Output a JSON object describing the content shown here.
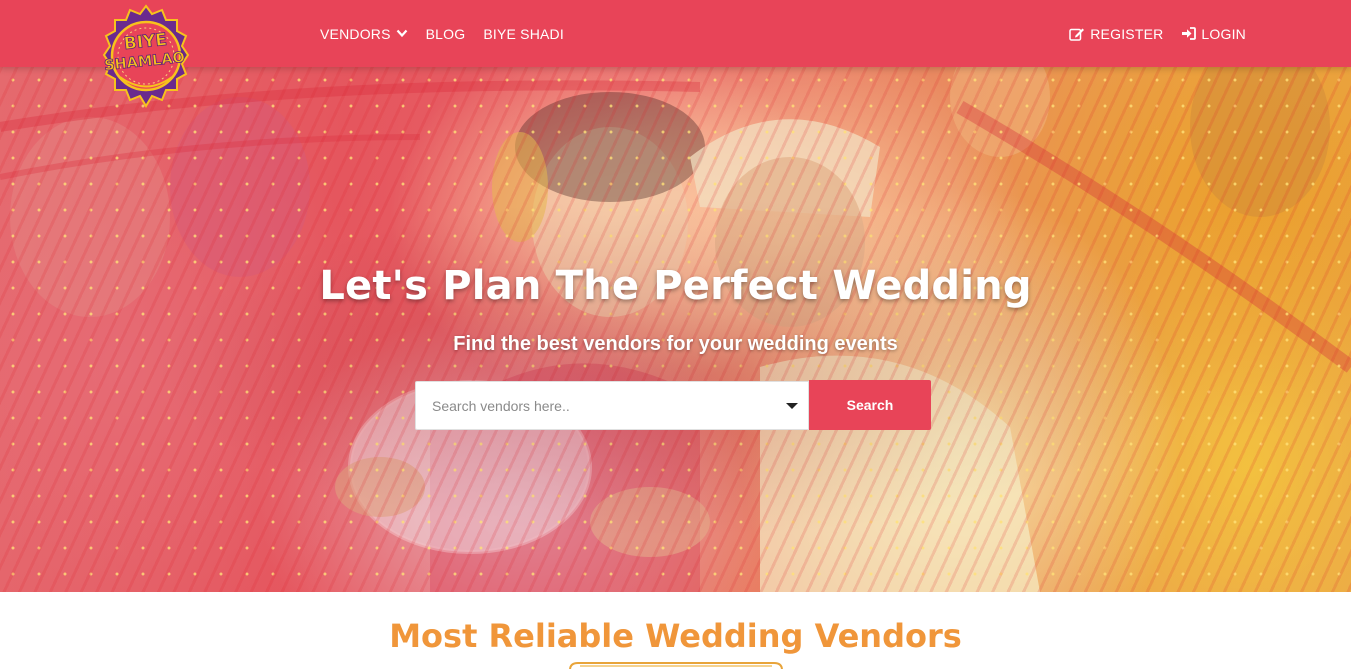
{
  "brand": {
    "logo_line1": "BIYE",
    "logo_line2": "SHAMLAO",
    "colors": {
      "primary": "#e84458",
      "accent": "#f0963a",
      "logo_purple": "#6a2a8e",
      "logo_yellow": "#f7c21c"
    }
  },
  "nav": {
    "left": [
      {
        "label": "VENDORS",
        "icon": "chevron-down-icon"
      },
      {
        "label": "BLOG"
      },
      {
        "label": "BIYE SHADI"
      }
    ],
    "right": [
      {
        "label": "REGISTER",
        "icon": "edit-icon"
      },
      {
        "label": "LOGIN",
        "icon": "sign-in-icon"
      }
    ]
  },
  "hero": {
    "title": "Let's Plan The Perfect Wedding",
    "subtitle": "Find the best vendors for your wedding events",
    "search": {
      "placeholder": "Search vendors here..",
      "value": "",
      "button_label": "Search"
    }
  },
  "section": {
    "title": "Most Reliable Wedding Vendors"
  }
}
